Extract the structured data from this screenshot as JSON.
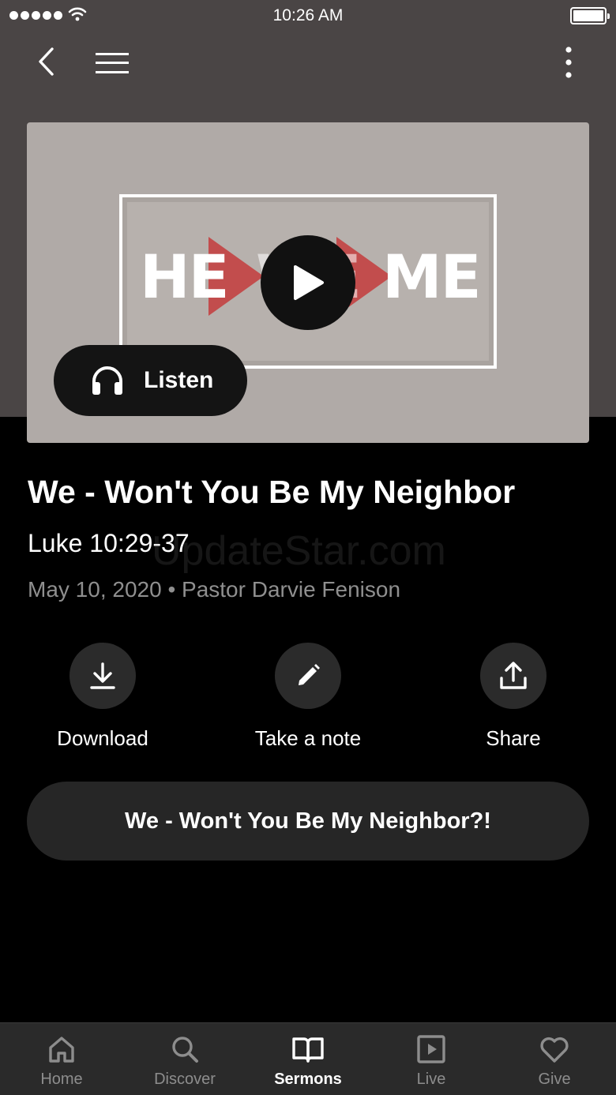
{
  "status_bar": {
    "time": "10:26 AM"
  },
  "hero": {
    "artwork_text_left": "HE",
    "artwork_text_center": "WE",
    "artwork_text_right": "ME",
    "listen_label": "Listen"
  },
  "sermon": {
    "title": "We - Won't You Be My Neighbor",
    "scripture": "Luke 10:29-37",
    "meta": "May 10, 2020 • Pastor Darvie Fenison",
    "watermark": "UpdateStar.com"
  },
  "actions": [
    {
      "label": "Download",
      "icon": "download-icon"
    },
    {
      "label": "Take a note",
      "icon": "pencil-icon"
    },
    {
      "label": "Share",
      "icon": "share-icon"
    }
  ],
  "sermon_link_label": "We - Won't You Be My Neighbor?!",
  "tabs": [
    {
      "label": "Home",
      "icon": "home-icon",
      "active": false
    },
    {
      "label": "Discover",
      "icon": "search-icon",
      "active": false
    },
    {
      "label": "Sermons",
      "icon": "book-icon",
      "active": true
    },
    {
      "label": "Live",
      "icon": "play-square-icon",
      "active": false
    },
    {
      "label": "Give",
      "icon": "heart-icon",
      "active": false
    }
  ],
  "colors": {
    "header_bg": "#4a4545",
    "accent_red": "#c43c3c",
    "tab_bar_bg": "#2a2a2a"
  }
}
